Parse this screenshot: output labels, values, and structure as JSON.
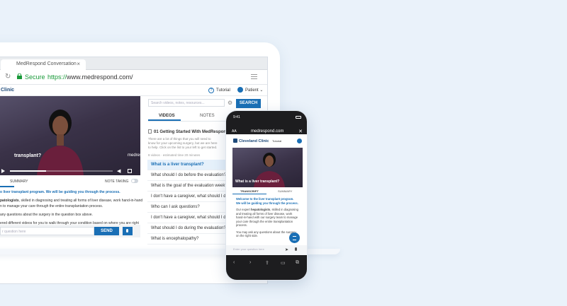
{
  "browser": {
    "tab_title": "MedRespond Conversation",
    "tab_close": "×",
    "secure_label": "Secure",
    "url_proto": "https://",
    "url_rest": "www.medrespond.com/"
  },
  "app": {
    "brand": "Clinic",
    "tutorial": "Tutorial",
    "patient": "Patient",
    "patient_caret": "⌄"
  },
  "video": {
    "title": "transplant?",
    "logo": "medrespond",
    "progress": 0.35
  },
  "left_tabs": {
    "summary": "SUMMARY",
    "note_taking": "NOTE TAKING"
  },
  "transcript": {
    "line1": "o liver transplant program. We will be guiding you through the process.",
    "line2a": "patologists",
    "line2b": ", skilled in diagnosing and treating all forms of liver disease, work hand-in-hand",
    "line3": "n to manage your care through the entire transplantation process.",
    "line4": "any questions about the surgery in the question box above.",
    "line5": "ered different videos for you to walk through your condition based on where you are right"
  },
  "chat": {
    "placeholder": "r question here",
    "send": "SEND"
  },
  "right_panel": {
    "search_placeholder": "Search videos, notes, resources...",
    "search_button": "SEARCH",
    "tab_videos": "VIDEOS",
    "tab_notes": "NOTES",
    "section_title": "01  Getting Started With MedRespond",
    "description": "There are a lot of things that you will need to know for your upcoming surgery, but we are here to help. Click on the list to your left to get started.",
    "meta": "8 videos · estimated time 20 minutes",
    "questions": [
      "What is a liver transplant?",
      "What should I do before the evaluation?",
      "What is the goal of the evaluation week?",
      "I don't have a caregiver, what should I do?",
      "Who can I ask questions?",
      "I don't have a caregiver, what should I do?",
      "What should I do during the evaluation?",
      "What is encephalopathy?"
    ]
  },
  "phone": {
    "time": "9:41",
    "aa": "AA",
    "url": "medrespond.com",
    "close": "✕",
    "brand": "Cleveland Clinic",
    "tutorial": "Tutorial",
    "video_title": "What is a liver transplant?",
    "tab_transcript": "TRANSCRIPT",
    "tab_summary": "SUMMARY",
    "p1": "Welcome to the liver transplant program. We will be guiding you through the process.",
    "p2a": "Our expert ",
    "p2b": "hepatologists",
    "p2c": ", skilled in diagnosing and treating all forms of liver disease, work hand-in-hand with our surgery team to manage your care through the entire transplantation process.",
    "p3": "You may ask any questions about the surgery on the right side.",
    "input_placeholder": "Enter your question here",
    "send_icon": "➤",
    "nav": [
      "‹",
      "›",
      "⇪",
      "▭",
      "⧉"
    ]
  }
}
